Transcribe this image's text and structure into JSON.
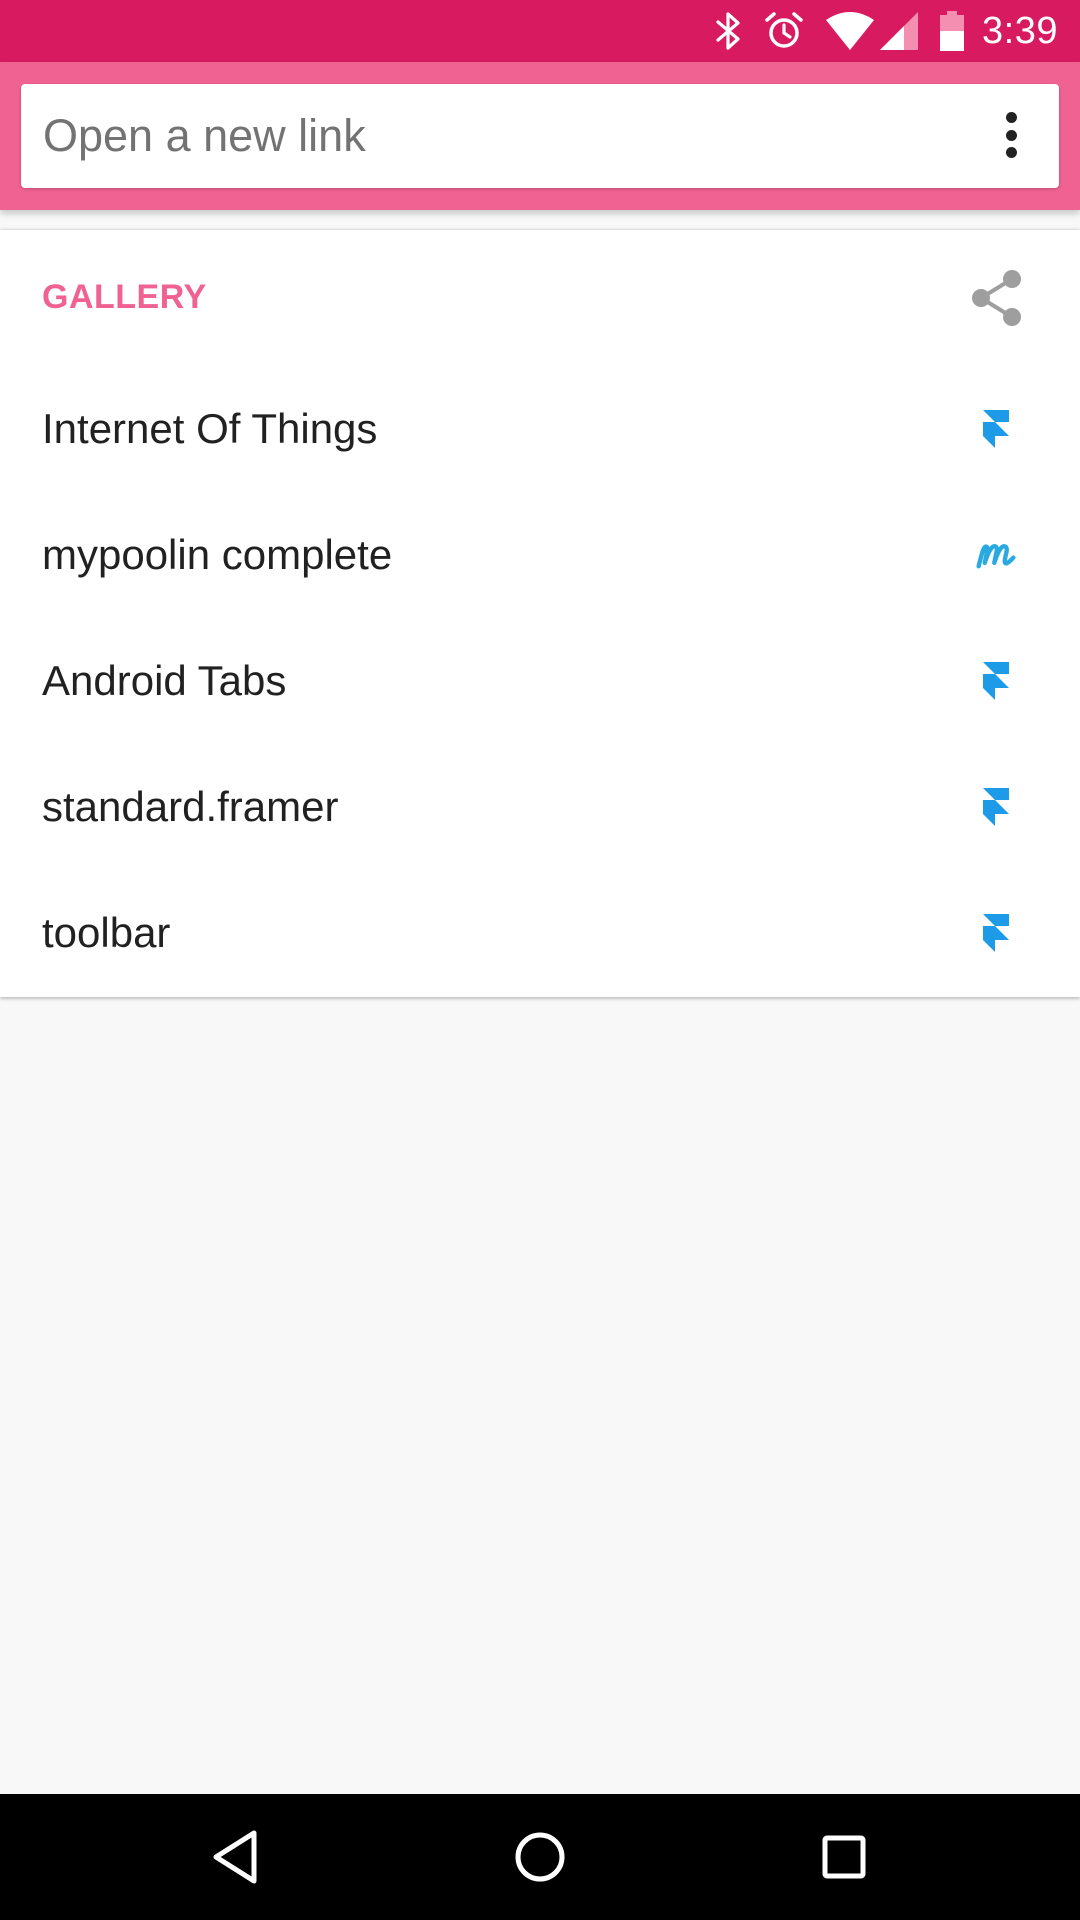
{
  "status_bar": {
    "time": "3:39",
    "icons": [
      "bluetooth-icon",
      "alarm-icon",
      "wifi-icon",
      "signal-icon",
      "battery-icon"
    ]
  },
  "search": {
    "placeholder": "Open a new link"
  },
  "gallery": {
    "title": "GALLERY",
    "items": [
      {
        "label": "Internet Of Things",
        "icon": "framer-icon"
      },
      {
        "label": "mypoolin complete",
        "icon": "marvel-icon"
      },
      {
        "label": "Android Tabs",
        "icon": "framer-icon"
      },
      {
        "label": "standard.framer",
        "icon": "framer-icon"
      },
      {
        "label": "toolbar",
        "icon": "framer-icon"
      }
    ]
  },
  "colors": {
    "status_bar": "#d81b60",
    "app_bar": "#f06292",
    "accent": "#f06292",
    "icon_blue": "#1e9be8"
  }
}
